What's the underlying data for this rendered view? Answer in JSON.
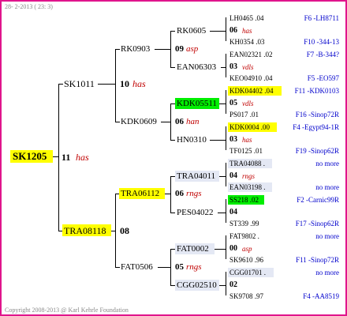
{
  "header": {
    "date": "28- 2-2013 ( 23: 3)"
  },
  "footer": {
    "copyright": "Copyright 2008-2013 @ Karl Kehrle Foundation"
  },
  "root": {
    "name": "SK1205",
    "num": "11",
    "lbl": "has"
  },
  "gen1": [
    {
      "name": "SK1011",
      "num": "10",
      "lbl": "has"
    },
    {
      "name": "TRA08118",
      "num": "08",
      "lbl": ""
    }
  ],
  "gen2": [
    {
      "name": "RK0903",
      "num": "09",
      "lbl": "asp"
    },
    {
      "name": "KDK0609",
      "num": "06",
      "lbl": "han"
    },
    {
      "name": "TRA06112",
      "num": "06",
      "lbl": "rngs"
    },
    {
      "name": "FAT0506",
      "num": "05",
      "lbl": "rngs"
    }
  ],
  "gen3": [
    {
      "name": "RK0605"
    },
    {
      "name": "EAN06303"
    },
    {
      "name": "KDK05511"
    },
    {
      "name": "HN0310"
    },
    {
      "name": "TRA04011"
    },
    {
      "name": "PES04022"
    },
    {
      "name": "FAT0002"
    },
    {
      "name": "CGG02510"
    }
  ],
  "gen4": [
    {
      "top": "LH0465 .04",
      "num": "06",
      "lbl": "has",
      "bot": "KH0354 .03",
      "topr": "F6 -LH8711",
      "botr": "F10 -344-13"
    },
    {
      "top": "EAN02321 .02",
      "num": "03",
      "lbl": "vdls",
      "bot": "KEO04910 .04",
      "topr": "F7 -B-344?",
      "botr": "F5 -EO597"
    },
    {
      "top": "KDK04402 .04",
      "num": "05",
      "lbl": "vdls",
      "bot": "PS017 .01",
      "topr": "F11 -KDK0103",
      "botr": "F16 -Sinop72R"
    },
    {
      "top": "KDK0004 .00",
      "num": "03",
      "lbl": "has",
      "bot": "TF0125 .01",
      "topr": "F4 -Egypt94-1R",
      "botr": "F19 -Sinop62R"
    },
    {
      "top": "TRA04088 .",
      "num": "04",
      "lbl": "rngs",
      "bot": "EAN03198 .",
      "topr": "no more",
      "botr": "no more"
    },
    {
      "top": "SS218 .02",
      "num": "04",
      "lbl": "",
      "bot": "ST339 .99",
      "topr": "F2 -Carnic99R",
      "botr": "F17 -Sinop62R"
    },
    {
      "top": "FAT9802 .",
      "num": "00",
      "lbl": "asp",
      "bot": "SK9610 .96",
      "topr": "no more",
      "botr": "F11 -Sinop72R"
    },
    {
      "top": "CGG01701 .",
      "num": "02",
      "lbl": "",
      "bot": "SK9708 .97",
      "topr": "no more",
      "botr": "F4 -AA8519"
    }
  ],
  "colors": {
    "border": "#e0158c",
    "yellow": "#ffff00",
    "green": "#00ee00",
    "lightgray": "#e4e8f4",
    "red": "#c00000",
    "blue": "#0000cc"
  }
}
